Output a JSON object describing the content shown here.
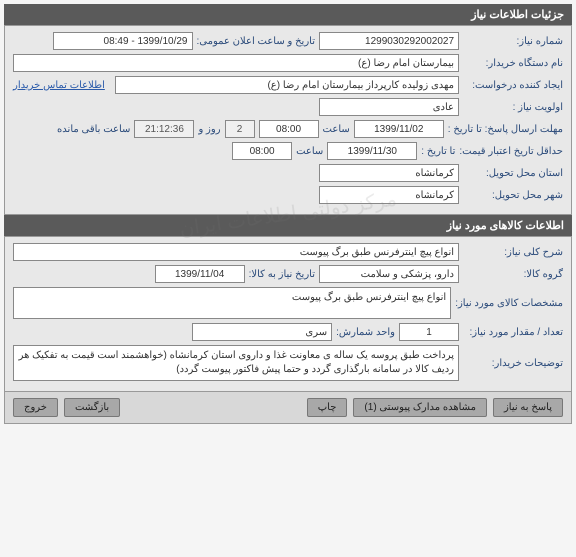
{
  "section1": {
    "title": "جزئیات اطلاعات نیاز",
    "need_number_label": "شماره نیاز:",
    "need_number": "1299030292002027",
    "public_date_label": "تاریخ و ساعت اعلان عمومی:",
    "public_date": "1399/10/29 - 08:49",
    "buyer_org_label": "نام دستگاه خریدار:",
    "buyer_org": "بیمارستان امام رضا (ع)",
    "creator_label": "ایجاد کننده درخواست:",
    "creator": "مهدی زولیده کارپرداز بیمارستان امام رضا (ع)",
    "contact_link": "اطلاعات تماس خریدار",
    "priority_label": "اولویت نیاز :",
    "priority": "عادی",
    "deadline_label": "مهلت ارسال پاسخ:  تا تاریخ :",
    "deadline_date": "1399/11/02",
    "time_label": "ساعت",
    "deadline_time": "08:00",
    "days_left": "2",
    "days_label": "روز و",
    "time_left": "21:12:36",
    "time_left_label": "ساعت باقی مانده",
    "validity_label": "حداقل تاریخ اعتبار قیمت:",
    "validity_to_label": "تا تاریخ :",
    "validity_date": "1399/11/30",
    "validity_time": "08:00",
    "province_label": "استان محل تحویل:",
    "province": "کرمانشاه",
    "city_label": "شهر محل تحویل:",
    "city": "کرمانشاه"
  },
  "section2": {
    "title": "اطلاعات کالاهای مورد نیاز",
    "desc_label": "شرح کلی نیاز:",
    "desc": "انواع پیچ اینترفرنس طبق برگ پیوست",
    "group_label": "گروه کالا:",
    "group": "دارو، پزشکی و سلامت",
    "need_date_label": "تاریخ نیاز به کالا:",
    "need_date": "1399/11/04",
    "spec_label": "مشخصات کالای مورد نیاز:",
    "spec": "انواع پیچ اینترفرنس طبق برگ پیوست",
    "qty_label": "تعداد / مقدار مورد نیاز:",
    "qty": "1",
    "unit_label": "واحد شمارش:",
    "unit": "سری",
    "buyer_notes_label": "توضیحات خریدار:",
    "buyer_notes": "پرداخت طبق پروسه یک ساله ی معاونت غذا و داروی استان کرمانشاه (خواهشمند است قیمت به تفکیک هر ردیف کالا در سامانه بارگذاری گردد و حتما پیش فاکتور پیوست گردد)"
  },
  "buttons": {
    "reply": "پاسخ به نیاز",
    "attachments": "مشاهده مدارک پیوستی (1)",
    "print": "چاپ",
    "back": "بازگشت",
    "exit": "خروج"
  },
  "watermark": "مرکز دولتی اطلاعات ایران"
}
